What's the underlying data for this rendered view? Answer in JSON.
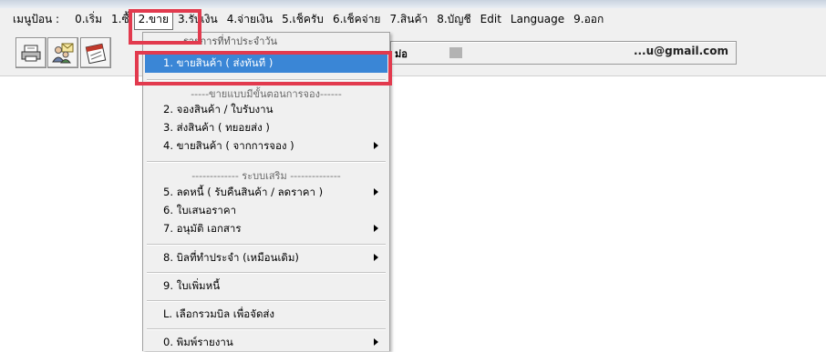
{
  "menubar": {
    "lead": "เมนูป้อน :",
    "items": [
      {
        "label": "0.เริ่ม"
      },
      {
        "label": "1.ซื้"
      },
      {
        "label": "2.ขาย"
      },
      {
        "label": "3.รับเงิน"
      },
      {
        "label": "4.จ่ายเงิน"
      },
      {
        "label": "5.เช็ครับ"
      },
      {
        "label": "6.เช็คจ่าย"
      },
      {
        "label": "7.สินค้า"
      },
      {
        "label": "8.บัญชี"
      },
      {
        "label": "Edit"
      },
      {
        "label": "Language"
      },
      {
        "label": "9.ออก"
      }
    ]
  },
  "toolbar": {
    "icons": [
      "printer-icon",
      "users-envelope-icon",
      "calendar-icon"
    ]
  },
  "status": {
    "fragment": "ม่อ",
    "email": "...u@gmail.com"
  },
  "dropdown": {
    "header_cut": "รายการที่ทำประจำวัน",
    "items": [
      {
        "label": "1. ขายสินค้า ( ส่งทันที )",
        "submenu": false
      },
      {
        "label": "2. จองสินค้า / ใบรับงาน",
        "submenu": false
      },
      {
        "label": "3. ส่งสินค้า  ( ทยอยส่ง )",
        "submenu": false
      },
      {
        "label": "4. ขายสินค้า ( จากการจอง )",
        "submenu": true
      },
      {
        "label": "5. ลดหนี้  ( รับคืนสินค้า / ลดราคา )",
        "submenu": true
      },
      {
        "label": "6. ใบเสนอราคา",
        "submenu": false
      },
      {
        "label": "7. อนุมัติ เอกสาร",
        "submenu": true
      },
      {
        "label": "8. บิลที่ทำประจำ (เหมือนเดิม)",
        "submenu": true
      },
      {
        "label": "9. ใบเพิ่มหนี้",
        "submenu": false
      },
      {
        "label": "L. เลือกรวมบิล เพื่อจัดส่ง",
        "submenu": false
      },
      {
        "label": "0. พิมพ์รายงาน",
        "submenu": true
      }
    ],
    "groups": {
      "reservation": "-----ขายแบบมีขั้นตอนการจอง------",
      "extra": "------------- ระบบเสริม --------------"
    }
  },
  "colors": {
    "highlight": "#3a86d6",
    "annotation": "#e23a4e"
  }
}
